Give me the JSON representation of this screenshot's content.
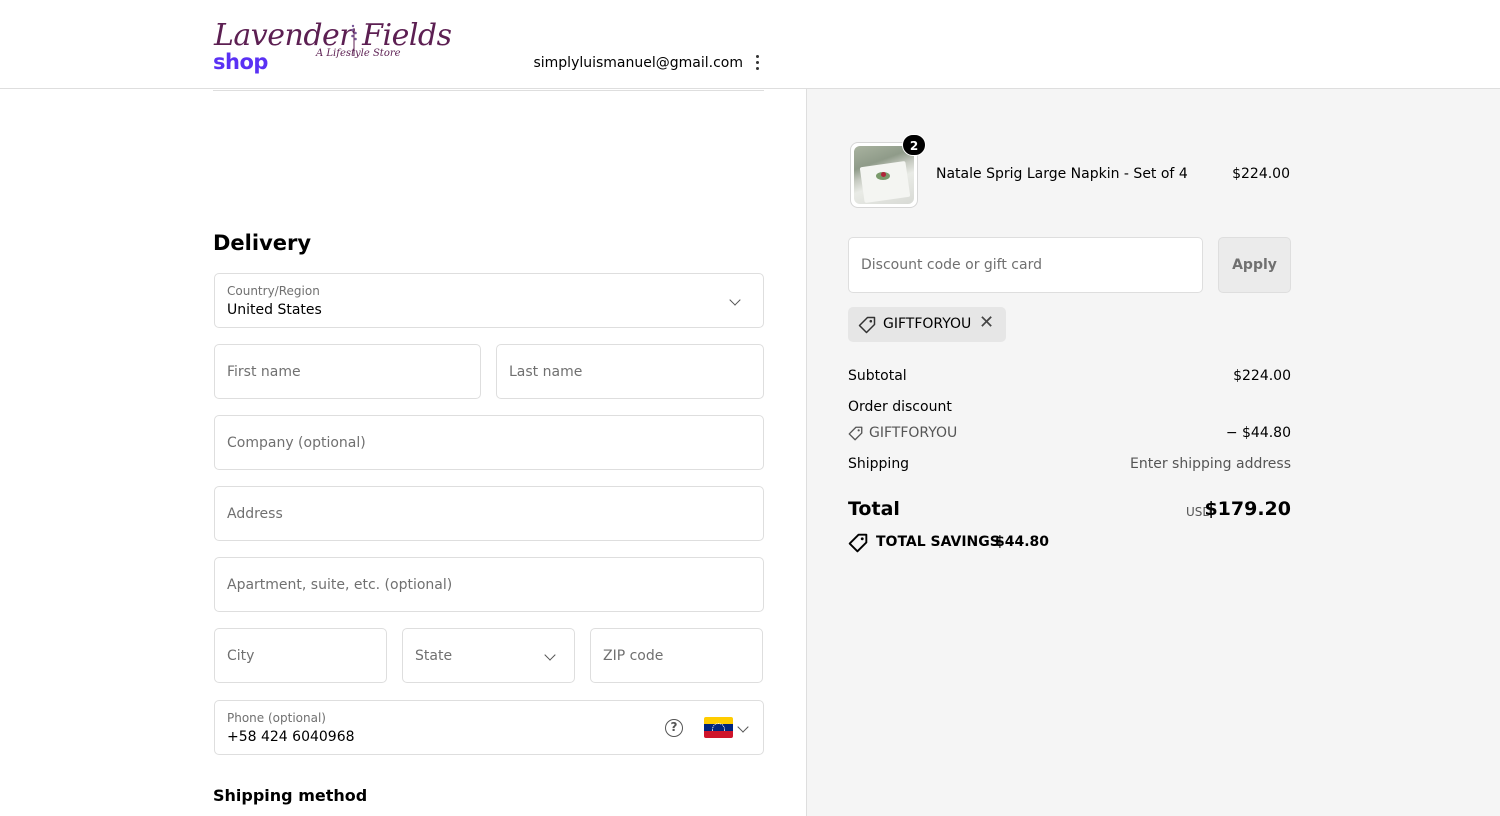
{
  "header": {
    "logo_main": "Lavender  Fields",
    "logo_sub": "A Lifestyle Store"
  },
  "shop": {
    "logo": "shop",
    "email": "simplyluismanuel@gmail.com"
  },
  "delivery": {
    "title": "Delivery",
    "country_label": "Country/Region",
    "country_value": "United States",
    "first_name_placeholder": "First name",
    "last_name_placeholder": "Last name",
    "company_placeholder": "Company (optional)",
    "address_placeholder": "Address",
    "apartment_placeholder": "Apartment, suite, etc. (optional)",
    "city_placeholder": "City",
    "state_placeholder": "State",
    "zip_placeholder": "ZIP code",
    "phone_label": "Phone (optional)",
    "phone_value": "+58 424 6040968",
    "phone_help_icon": "?"
  },
  "shipping_method": {
    "title": "Shipping method"
  },
  "order": {
    "item": {
      "quantity": "2",
      "name": "Natale Sprig Large Napkin - Set of 4",
      "price": "$224.00"
    },
    "discount_placeholder": "Discount code or gift card",
    "apply_label": "Apply",
    "applied_code": "GIFTFORYOU",
    "subtotal_label": "Subtotal",
    "subtotal_value": "$224.00",
    "order_discount_label": "Order discount",
    "discount_code": "GIFTFORYOU",
    "discount_value": "− $44.80",
    "shipping_label": "Shipping",
    "shipping_value": "Enter shipping address",
    "total_label": "Total",
    "total_currency": "USD",
    "total_value": "$179.20",
    "savings_label": "TOTAL SAVINGS",
    "savings_value": "$44.80"
  },
  "colors": {
    "shop_brand": "#5a31f4",
    "logo": "#5c1f52",
    "summary_bg": "#f5f5f5",
    "border": "#dedede"
  },
  "icons": [
    "kebab-menu-icon",
    "chevron-down-icon",
    "question-circle-icon",
    "venezuela-flag-icon",
    "tag-icon",
    "close-icon",
    "savings-tag-icon"
  ]
}
